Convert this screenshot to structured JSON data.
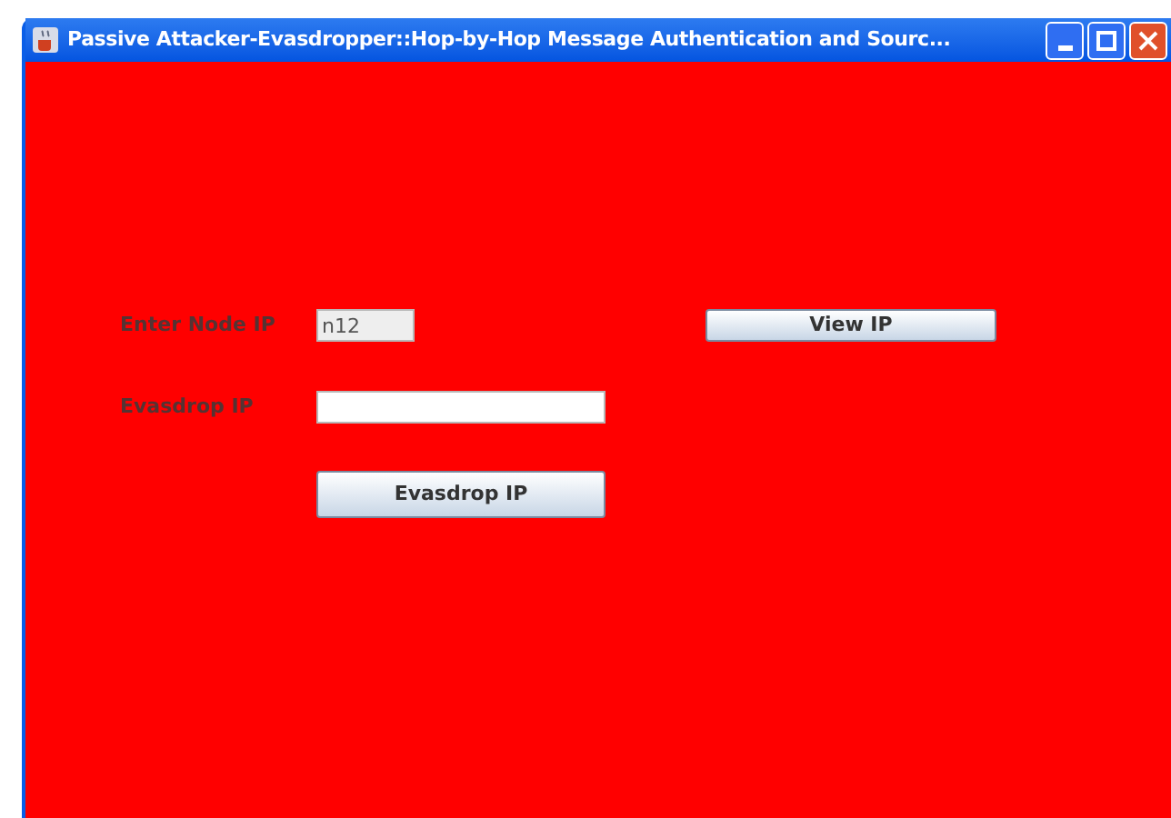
{
  "window": {
    "title": "Passive Attacker-Evasdropper::Hop-by-Hop Message Authentication and Sourc..."
  },
  "node_ip": {
    "label": "Enter Node IP",
    "value": "n12",
    "disabled": true
  },
  "view_button": {
    "label": "View IP"
  },
  "evasdrop_ip": {
    "label": "Evasdrop IP"
  },
  "evasdrop_button": {
    "label": "Evasdrop IP"
  }
}
